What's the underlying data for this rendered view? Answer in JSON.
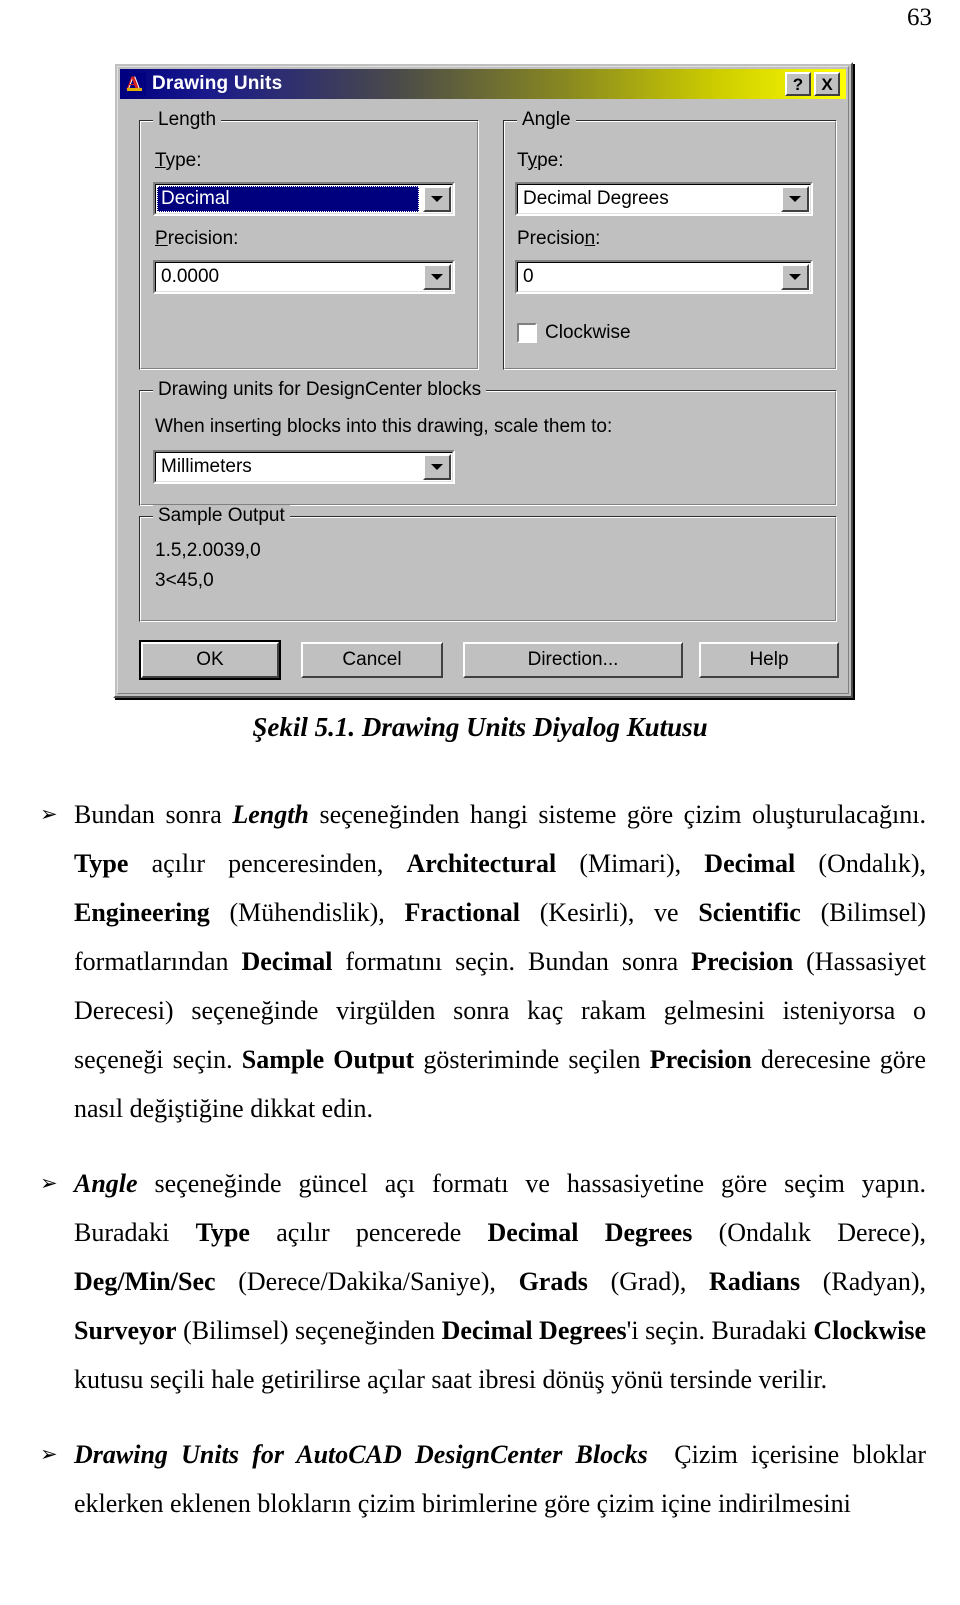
{
  "page": {
    "number": "63"
  },
  "dialog": {
    "title": "Drawing Units",
    "icon": "autocad-a-icon",
    "help_button": "?",
    "close_button": "X",
    "length": {
      "group_title": "Length",
      "type_label": "Type:",
      "type_value": "Decimal",
      "precision_label": "Precision:",
      "precision_value": "0.0000"
    },
    "angle": {
      "group_title": "Angle",
      "type_label": "Type:",
      "type_value": "Decimal Degrees",
      "precision_label": "Precision:",
      "precision_value": "0",
      "clockwise_label": "Clockwise",
      "clockwise_checked": false
    },
    "designcenter": {
      "group_title": "Drawing units for DesignCenter blocks",
      "description": "When inserting blocks into this drawing, scale them to:",
      "units_value": "Millimeters"
    },
    "sample_output": {
      "group_title": "Sample Output",
      "line1": "1.5,2.0039,0",
      "line2": "3<45,0"
    },
    "buttons": {
      "ok": "OK",
      "cancel": "Cancel",
      "direction": "Direction...",
      "help": "Help"
    }
  },
  "figure": {
    "caption": "Şekil 5.1. Drawing Units Diyalog Kutusu"
  },
  "body": {
    "bullet_glyph": "➢",
    "items": [
      {
        "html": "Bundan sonra <i class=\"bi\">Length</i> seçeneğinden hangi sisteme göre çizim oluşturulacağını. <b>Type</b> açılır penceresinden, <b>Architectural</b> (Mimari), <b>Decimal</b> (Ondalık), <b>Engineering</b> (Mühendislik), <b>Fractional</b> (Kesirli), ve <b>Scientific</b> (Bilimsel) formatlarından <b>Decimal</b> formatını seçin. Bundan sonra <b>Precision</b> (Hassasiyet Derecesi) seçeneğinde virgülden sonra kaç rakam gelmesini isteniyorsa o seçeneği seçin. <b>Sample Output</b> gösteriminde seçilen <b>Precision</b> derecesine göre nasıl değiştiğine dikkat edin."
      },
      {
        "html": "<i class=\"bi\">Angle</i> seçeneğinde güncel açı formatı ve hassasiyetine göre seçim yapın. Buradaki <b>Type</b> açılır pencerede <b>Decimal Degrees</b> (Ondalık Derece), <b>Deg/Min/Sec</b> (Derece/Dakika/Saniye), <b>Grads</b> (Grad), <b>Radians</b> (Radyan), <b>Surveyor</b> (Bilimsel) seçeneğinden <b>Decimal Degrees</b>'i seçin. Buradaki <b>Clockwise</b> kutusu seçili hale getirilirse açılar saat ibresi dönüş yönü tersinde verilir."
      },
      {
        "html": "<i class=\"bi\">Drawing Units for AutoCAD DesignCenter Blocks</i>&nbsp; Çizim içerisine bloklar eklerken eklenen blokların çizim birimlerine göre çizim içine indirilmesini"
      }
    ]
  }
}
